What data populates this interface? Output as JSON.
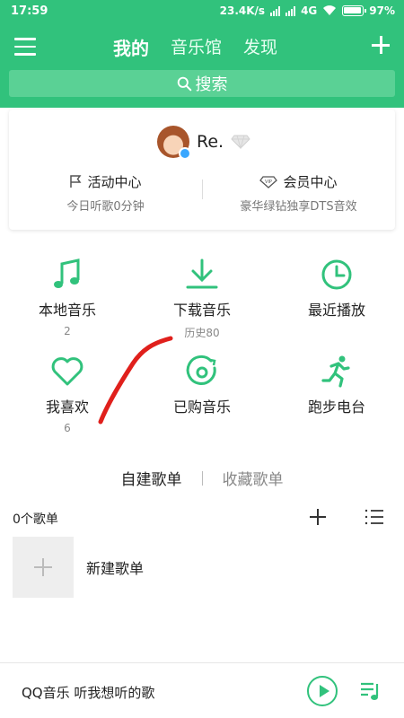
{
  "status_bar": {
    "time": "17:59",
    "net_speed": "23.4K/s",
    "network": "4G",
    "battery": "97%",
    "battery_level": 0.97
  },
  "header": {
    "tabs": [
      {
        "label": "我的",
        "active": true
      },
      {
        "label": "音乐馆",
        "active": false
      },
      {
        "label": "发现",
        "active": false
      }
    ],
    "search_label": "搜索"
  },
  "profile": {
    "username": "Re.",
    "activity": {
      "title": "活动中心",
      "subtitle": "今日听歌0分钟"
    },
    "vip": {
      "title": "会员中心",
      "subtitle": "豪华绿钻独享DTS音效"
    }
  },
  "grid": [
    {
      "label": "本地音乐",
      "count": "2",
      "icon": "music-note-icon"
    },
    {
      "label": "下载音乐",
      "count": "历史80",
      "icon": "download-icon"
    },
    {
      "label": "最近播放",
      "count": "",
      "icon": "clock-icon"
    },
    {
      "label": "我喜欢",
      "count": "6",
      "icon": "heart-icon"
    },
    {
      "label": "已购音乐",
      "count": "",
      "icon": "purchased-disc-icon"
    },
    {
      "label": "跑步电台",
      "count": "",
      "icon": "runner-icon"
    }
  ],
  "playlists": {
    "tabs": [
      {
        "label": "自建歌单",
        "active": true
      },
      {
        "label": "收藏歌单",
        "active": false
      }
    ],
    "count_label": "0个歌单",
    "new_label": "新建歌单"
  },
  "player": {
    "text": "QQ音乐 听我想听的歌"
  },
  "colors": {
    "brand_green": "#31c27c",
    "annotation_red": "#e0201c"
  }
}
